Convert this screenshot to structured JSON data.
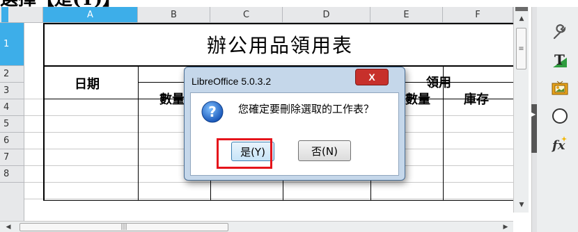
{
  "top_caption": "選擇【是(Y)】",
  "columns": [
    "A",
    "B",
    "C",
    "D",
    "E",
    "F"
  ],
  "rows": [
    "1",
    "2",
    "3",
    "4",
    "5",
    "6",
    "7",
    "8"
  ],
  "sheet": {
    "title": "辦公用品領用表",
    "date_header": "日期",
    "qty_b3": "數量",
    "col_e_partial": "數量",
    "receive_header": "領用",
    "stock_header": "庫存"
  },
  "dialog": {
    "title": "LibreOffice 5.0.3.2",
    "close_label": "X",
    "message": "您確定要刪除選取的工作表？",
    "yes_label": "是(Y)",
    "no_label": "否(N)"
  },
  "colors": {
    "selection": "#3daee9",
    "highlight_border": "#e5141b",
    "dialog_frame": "#c5d7ea"
  },
  "sidebar_icons": [
    "properties-icon",
    "styles-icon",
    "gallery-icon",
    "navigator-icon",
    "functions-icon"
  ]
}
